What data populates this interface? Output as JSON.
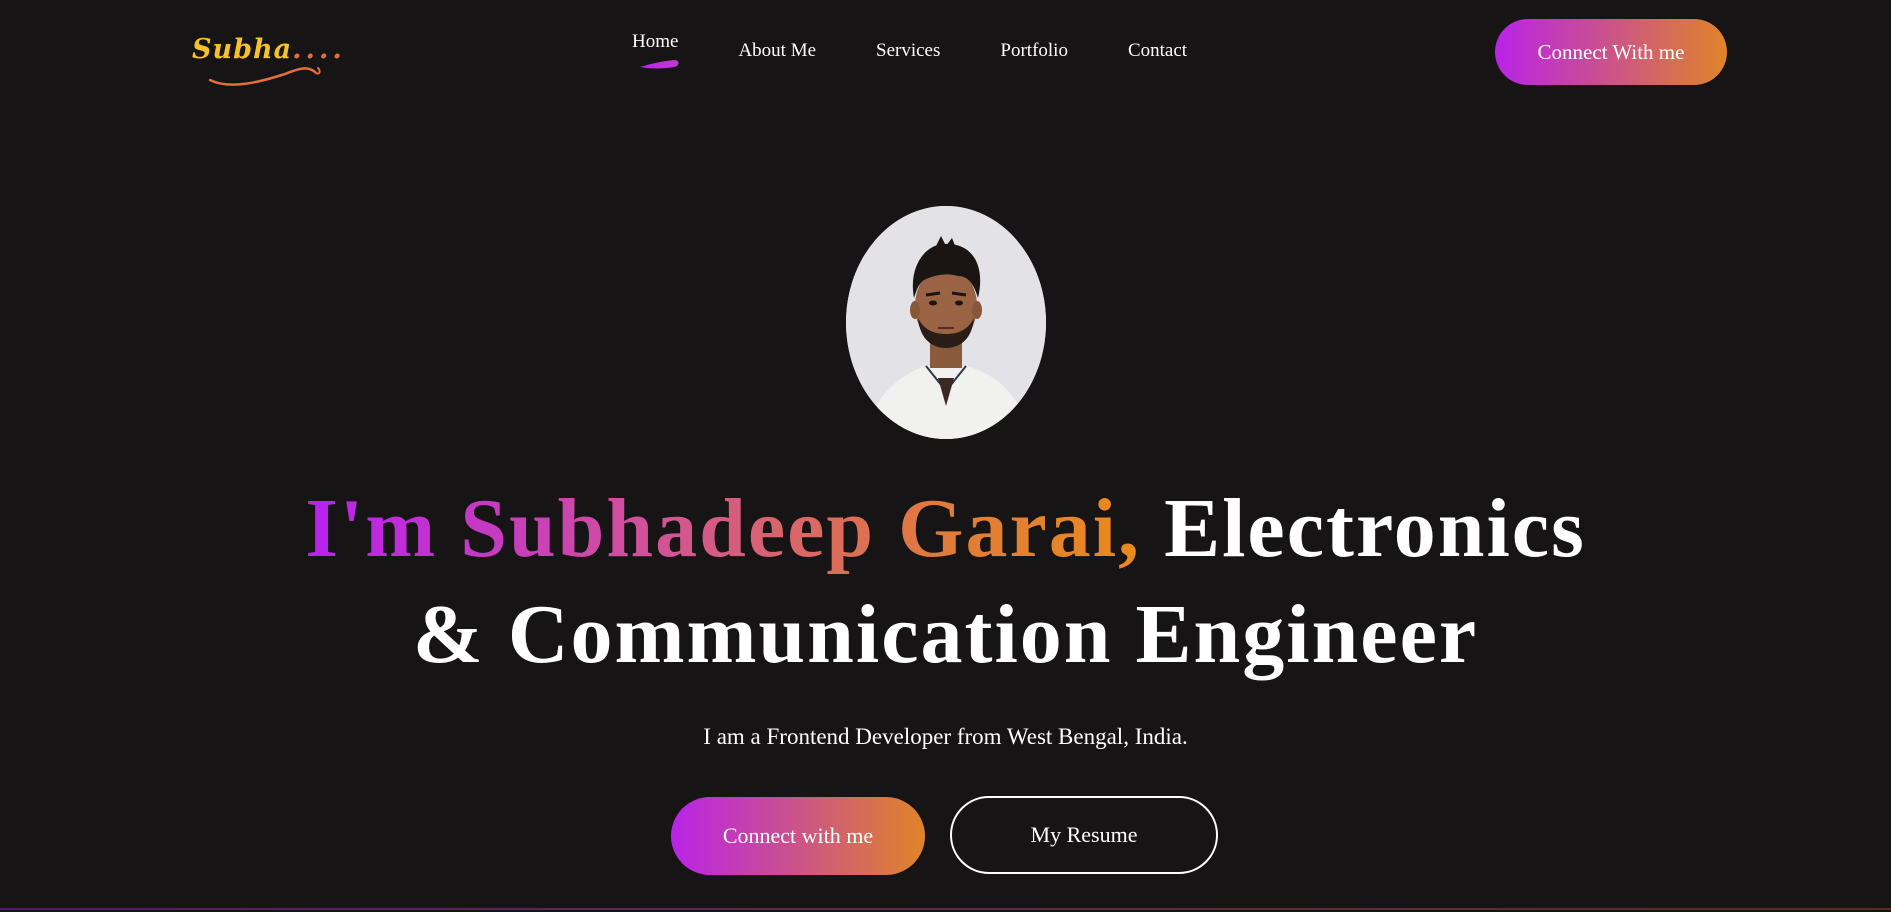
{
  "brand": {
    "logo_text": "Subha",
    "logo_dots": "....",
    "logo_color": "#f6c22a",
    "logo_accent": "#e2703a"
  },
  "nav": {
    "items": [
      {
        "label": "Home",
        "active": true
      },
      {
        "label": "About Me",
        "active": false
      },
      {
        "label": "Services",
        "active": false
      },
      {
        "label": "Portfolio",
        "active": false
      },
      {
        "label": "Contact",
        "active": false
      }
    ],
    "cta_label": "Connect With me"
  },
  "hero": {
    "title_gradient": "I'm Subhadeep Garai,",
    "title_rest_line1": " Electronics",
    "title_line2": "& Communication Engineer",
    "subtitle": "I am a Frontend Developer from West Bengal, India.",
    "primary_button": "Connect with me",
    "secondary_button": "My Resume"
  },
  "colors": {
    "background": "#161414",
    "gradient_start": "#b923e8",
    "gradient_end": "#df8428",
    "text": "#ffffff"
  }
}
